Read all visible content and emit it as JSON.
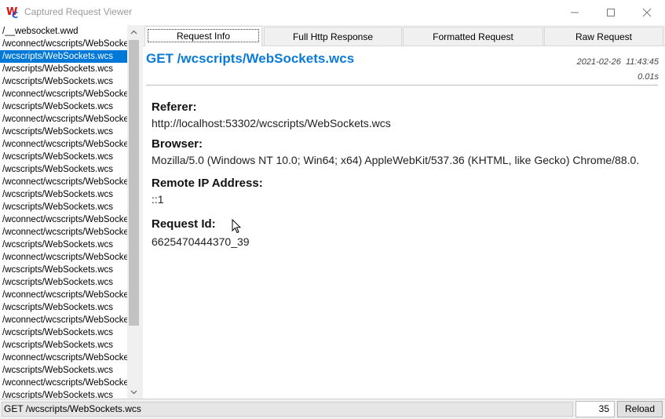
{
  "window": {
    "title": "Captured Request Viewer",
    "app_icon": "wc-app-icon",
    "controls": [
      "minimize-icon",
      "maximize-icon",
      "close-icon"
    ]
  },
  "request_list": {
    "selected_index": 2,
    "items": [
      "/__websocket.wwd",
      "/wconnect/wcscripts/WebSockets",
      "/wcscripts/WebSockets.wcs",
      "/wcscripts/WebSockets.wcs",
      "/wcscripts/WebSockets.wcs",
      "/wconnect/wcscripts/WebSockets",
      "/wcscripts/WebSockets.wcs",
      "/wconnect/wcscripts/WebSockets",
      "/wcscripts/WebSockets.wcs",
      "/wconnect/wcscripts/WebSockets",
      "/wcscripts/WebSockets.wcs",
      "/wcscripts/WebSockets.wcs",
      "/wconnect/wcscripts/WebSockets",
      "/wcscripts/WebSockets.wcs",
      "/wcscripts/WebSockets.wcs",
      "/wconnect/wcscripts/WebSockets",
      "/wconnect/wcscripts/WebSockets",
      "/wcscripts/WebSockets.wcs",
      "/wconnect/wcscripts/WebSockets",
      "/wcscripts/WebSockets.wcs",
      "/wcscripts/WebSockets.wcs",
      "/wconnect/wcscripts/WebSockets",
      "/wcscripts/WebSockets.wcs",
      "/wconnect/wcscripts/WebSockets",
      "/wcscripts/WebSockets.wcs",
      "/wcscripts/WebSockets.wcs",
      "/wconnect/wcscripts/WebSockets",
      "/wcscripts/WebSockets.wcs",
      "/wconnect/wcscripts/WebSockets",
      "/wcscripts/WebSockets.wcs"
    ]
  },
  "tabs": [
    {
      "label": "Request Info",
      "active": true
    },
    {
      "label": "Full Http Response",
      "active": false
    },
    {
      "label": "Formatted Request",
      "active": false
    },
    {
      "label": "Raw Request",
      "active": false
    }
  ],
  "request_info": {
    "title": "GET /wcscripts/WebSockets.wcs",
    "date": "2021-02-26",
    "time": "11:43:45",
    "duration": "0.01s",
    "fields": [
      {
        "label": "Referer:",
        "value": "http://localhost:53302/wcscripts/WebSockets.wcs"
      },
      {
        "label": "Browser:",
        "value": "Mozilla/5.0 (Windows NT 10.0; Win64; x64) AppleWebKit/537.36 (KHTML, like Gecko) Chrome/88.0."
      },
      {
        "label": "Remote IP Address:",
        "value": "::1"
      },
      {
        "label": "Request Id:",
        "value": "6625470444370_39"
      }
    ]
  },
  "statusbar": {
    "status_text": "GET /wcscripts/WebSockets.wcs",
    "count": "35",
    "reload_label": "Reload"
  },
  "colors": {
    "accent": "#0078d7",
    "title_blue": "#0a7bd6"
  }
}
